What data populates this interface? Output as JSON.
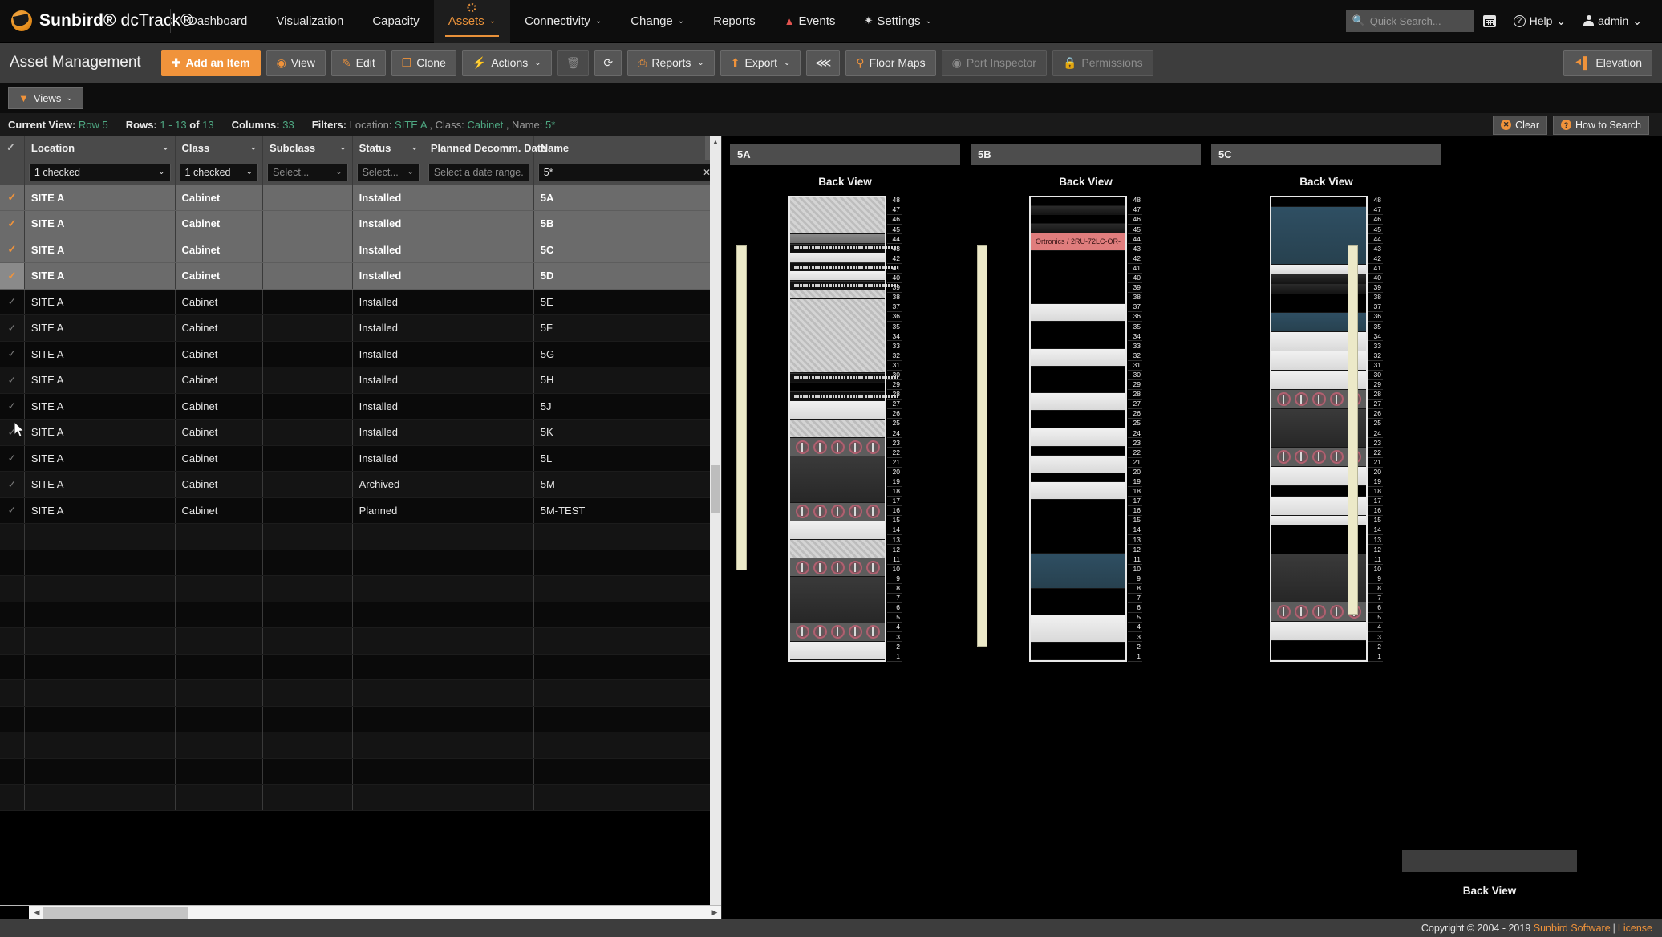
{
  "topnav": {
    "brand_name": "Sunbird®",
    "brand_product": "dcTrack®",
    "items": [
      {
        "label": "Dashboard",
        "active": false,
        "caret": ""
      },
      {
        "label": "Visualization",
        "active": false,
        "caret": ""
      },
      {
        "label": "Capacity",
        "active": false,
        "caret": ""
      },
      {
        "label": "Assets",
        "active": true,
        "caret": "⌄"
      },
      {
        "label": "Connectivity",
        "active": false,
        "caret": "⌄"
      },
      {
        "label": "Change",
        "active": false,
        "caret": "⌄"
      },
      {
        "label": "Reports",
        "active": false,
        "caret": ""
      },
      {
        "label": "Events",
        "active": false,
        "caret": ""
      },
      {
        "label": "Settings",
        "active": false,
        "caret": "⌄"
      }
    ],
    "quick_search_placeholder": "Quick Search...",
    "quick_search_value": "",
    "help_label": "Help",
    "user_label": "admin"
  },
  "actionbar": {
    "page_title": "Asset Management",
    "buttons": [
      {
        "label": "Add an Item",
        "icon": "+",
        "style": "primary"
      },
      {
        "label": "View",
        "icon": "◉",
        "style": "normal"
      },
      {
        "label": "Edit",
        "icon": "✎",
        "style": "normal"
      },
      {
        "label": "Clone",
        "icon": "❐",
        "style": "normal"
      },
      {
        "label": "Actions",
        "icon": "⚡",
        "style": "normal",
        "caret": "⌄"
      },
      {
        "label": "",
        "icon": "🗑",
        "style": "disabled"
      },
      {
        "label": "",
        "icon": "⟳",
        "style": "normal"
      },
      {
        "label": "Reports",
        "icon": "🖨",
        "style": "normal",
        "caret": "⌄"
      },
      {
        "label": "Export",
        "icon": "⬆",
        "style": "normal",
        "caret": "⌄"
      },
      {
        "label": "",
        "icon": "⦙⦙",
        "style": "normal"
      },
      {
        "label": "Floor Maps",
        "icon": "📍",
        "style": "normal"
      },
      {
        "label": "Port Inspector",
        "icon": "◉",
        "style": "disabled"
      },
      {
        "label": "Permissions",
        "icon": "🔒",
        "style": "disabled"
      }
    ],
    "elevation_label": "Elevation"
  },
  "viewsbar": {
    "views_label": "Views"
  },
  "infobar": {
    "current_view_label": "Current View:",
    "current_view_value": "Row 5",
    "rows_label": "Rows:",
    "rows_value": "1 - 13",
    "rows_of": "of",
    "rows_total": "13",
    "columns_label": "Columns:",
    "columns_value": "33",
    "filters_label": "Filters:",
    "filter_location_key": "Location:",
    "filter_location_value": "SITE A",
    "filter_class_key": ", Class:",
    "filter_class_value": "Cabinet",
    "filter_name_key": ", Name:",
    "filter_name_value": "5*",
    "clear_label": "Clear",
    "how_to_search_label": "How to Search"
  },
  "grid": {
    "columns": [
      {
        "label": "Location",
        "caret": "⌄",
        "filter_type": "select",
        "filter_value": "1 checked"
      },
      {
        "label": "Class",
        "caret": "⌄",
        "filter_type": "select",
        "filter_value": "1 checked"
      },
      {
        "label": "Subclass",
        "caret": "⌄",
        "filter_type": "select",
        "filter_value": "Select..."
      },
      {
        "label": "Status",
        "caret": "⌄",
        "filter_type": "select",
        "filter_value": "Select..."
      },
      {
        "label": "Planned Decomm. Date",
        "caret": "",
        "filter_type": "date",
        "filter_value": "",
        "filter_placeholder": "Select a date range..."
      },
      {
        "label": "Name",
        "caret": "",
        "filter_type": "text",
        "filter_value": "5*"
      }
    ],
    "rows": [
      {
        "location": "SITE A",
        "class": "Cabinet",
        "subclass": "",
        "status": "Installed",
        "decomm": "",
        "name": "5A",
        "selected": true
      },
      {
        "location": "SITE A",
        "class": "Cabinet",
        "subclass": "",
        "status": "Installed",
        "decomm": "",
        "name": "5B",
        "selected": true
      },
      {
        "location": "SITE A",
        "class": "Cabinet",
        "subclass": "",
        "status": "Installed",
        "decomm": "",
        "name": "5C",
        "selected": true
      },
      {
        "location": "SITE A",
        "class": "Cabinet",
        "subclass": "",
        "status": "Installed",
        "decomm": "",
        "name": "5D",
        "selected": true
      },
      {
        "location": "SITE A",
        "class": "Cabinet",
        "subclass": "",
        "status": "Installed",
        "decomm": "",
        "name": "5E",
        "selected": false
      },
      {
        "location": "SITE A",
        "class": "Cabinet",
        "subclass": "",
        "status": "Installed",
        "decomm": "",
        "name": "5F",
        "selected": false
      },
      {
        "location": "SITE A",
        "class": "Cabinet",
        "subclass": "",
        "status": "Installed",
        "decomm": "",
        "name": "5G",
        "selected": false
      },
      {
        "location": "SITE A",
        "class": "Cabinet",
        "subclass": "",
        "status": "Installed",
        "decomm": "",
        "name": "5H",
        "selected": false
      },
      {
        "location": "SITE A",
        "class": "Cabinet",
        "subclass": "",
        "status": "Installed",
        "decomm": "",
        "name": "5J",
        "selected": false
      },
      {
        "location": "SITE A",
        "class": "Cabinet",
        "subclass": "",
        "status": "Installed",
        "decomm": "",
        "name": "5K",
        "selected": false
      },
      {
        "location": "SITE A",
        "class": "Cabinet",
        "subclass": "",
        "status": "Installed",
        "decomm": "",
        "name": "5L",
        "selected": false
      },
      {
        "location": "SITE A",
        "class": "Cabinet",
        "subclass": "",
        "status": "Archived",
        "decomm": "",
        "name": "5M",
        "selected": false
      },
      {
        "location": "SITE A",
        "class": "Cabinet",
        "subclass": "",
        "status": "Planned",
        "decomm": "",
        "name": "5M-TEST",
        "selected": false
      }
    ]
  },
  "elevation": {
    "view_label": "Back View",
    "cabinets": [
      {
        "name": "5A",
        "view": "Back View"
      },
      {
        "name": "5B",
        "view": "Back View"
      },
      {
        "name": "5C",
        "view": "Back View"
      }
    ],
    "fourth_view_label": "Back View",
    "ru_max": 48,
    "ru_min": 1,
    "alert_item_label": "Ortronics / 2RU-72LC-OR-"
  },
  "footer": {
    "copyright": "Copyright © 2004 - 2019",
    "company": "Sunbird Software",
    "separator": "|",
    "license": "License"
  },
  "colors": {
    "accent": "#f0933b",
    "nav_bg": "#0d0d0d",
    "toolbar_bg": "#3d3d3d",
    "green_value": "#4ea882",
    "alert_red": "#e07d7d"
  }
}
